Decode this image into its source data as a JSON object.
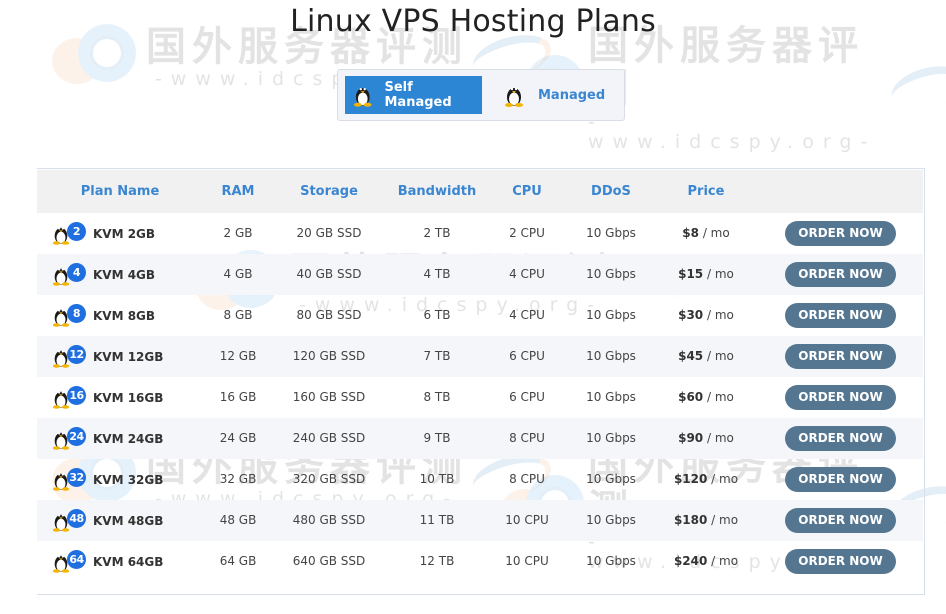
{
  "page": {
    "title": "Linux VPS Hosting Plans"
  },
  "watermark": {
    "text_cn": "国外服务器评测",
    "text_url": "-www.idcspy.org-"
  },
  "tabs": [
    {
      "label": "Self Managed",
      "icon": "linux-tux-icon",
      "active": true
    },
    {
      "label": "Managed",
      "icon": "linux-tux-icon",
      "active": false
    }
  ],
  "table": {
    "columns": [
      "Plan Name",
      "RAM",
      "Storage",
      "Bandwidth",
      "CPU",
      "DDoS",
      "Price"
    ],
    "order_label": "ORDER NOW",
    "price_suffix": "/ mo",
    "rows": [
      {
        "badge": "2",
        "name": "KVM 2GB",
        "ram": "2 GB",
        "storage": "20 GB SSD",
        "bandwidth": "2 TB",
        "cpu": "2 CPU",
        "ddos": "10 Gbps",
        "price": "$8"
      },
      {
        "badge": "4",
        "name": "KVM 4GB",
        "ram": "4 GB",
        "storage": "40 GB SSD",
        "bandwidth": "4 TB",
        "cpu": "4 CPU",
        "ddos": "10 Gbps",
        "price": "$15"
      },
      {
        "badge": "8",
        "name": "KVM 8GB",
        "ram": "8 GB",
        "storage": "80 GB SSD",
        "bandwidth": "6 TB",
        "cpu": "4 CPU",
        "ddos": "10 Gbps",
        "price": "$30"
      },
      {
        "badge": "12",
        "name": "KVM 12GB",
        "ram": "12 GB",
        "storage": "120 GB SSD",
        "bandwidth": "7 TB",
        "cpu": "6 CPU",
        "ddos": "10 Gbps",
        "price": "$45"
      },
      {
        "badge": "16",
        "name": "KVM 16GB",
        "ram": "16 GB",
        "storage": "160 GB SSD",
        "bandwidth": "8 TB",
        "cpu": "6 CPU",
        "ddos": "10 Gbps",
        "price": "$60"
      },
      {
        "badge": "24",
        "name": "KVM 24GB",
        "ram": "24 GB",
        "storage": "240 GB SSD",
        "bandwidth": "9 TB",
        "cpu": "8 CPU",
        "ddos": "10 Gbps",
        "price": "$90"
      },
      {
        "badge": "32",
        "name": "KVM 32GB",
        "ram": "32 GB",
        "storage": "320 GB SSD",
        "bandwidth": "10 TB",
        "cpu": "8 CPU",
        "ddos": "10 Gbps",
        "price": "$120"
      },
      {
        "badge": "48",
        "name": "KVM 48GB",
        "ram": "48 GB",
        "storage": "480 GB SSD",
        "bandwidth": "11 TB",
        "cpu": "10 CPU",
        "ddos": "10 Gbps",
        "price": "$180"
      },
      {
        "badge": "64",
        "name": "KVM 64GB",
        "ram": "64 GB",
        "storage": "640 GB SSD",
        "bandwidth": "12 TB",
        "cpu": "10 CPU",
        "ddos": "10 Gbps",
        "price": "$240"
      }
    ]
  },
  "colors": {
    "accent_blue": "#2d86d4",
    "header_text": "#3a86d1",
    "badge_blue": "#1f6fe0",
    "order_button": "#557691",
    "header_bg": "#f1f1f1",
    "row_alt_bg": "#f5f6f9"
  }
}
